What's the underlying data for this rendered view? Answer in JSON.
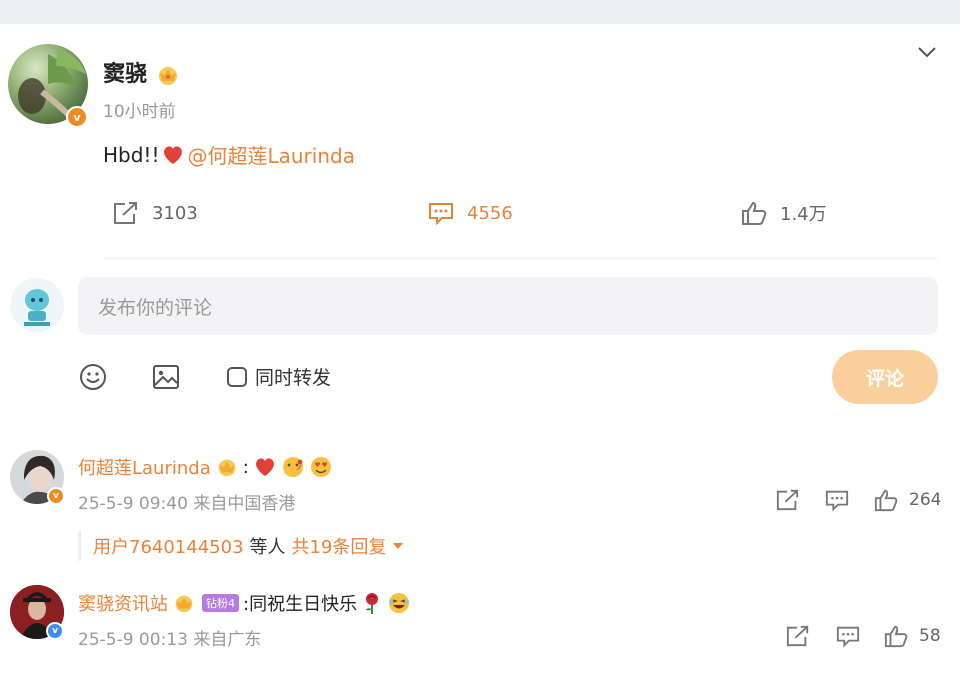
{
  "post": {
    "author": "窦骁",
    "time": "10小时前",
    "text": "Hbd!! ",
    "mention": "@何超莲Laurinda",
    "repost_count": "3103",
    "comment_count": "4556",
    "like_count": "1.4万"
  },
  "composer": {
    "placeholder": "发布你的评论",
    "repost_label": "同时转发",
    "submit_label": "评论"
  },
  "comments": [
    {
      "author": "何超莲Laurinda",
      "text": ":",
      "meta": "25-5-9 09:40 来自中国香港",
      "likes": "264",
      "replies": {
        "who": "用户7640144503",
        "mid": "等人",
        "count": "共19条回复"
      }
    },
    {
      "author": "窦骁资讯站",
      "fan_badge": "钻粉4",
      "text": ":同祝生日快乐",
      "meta": "25-5-9 00:13 来自广东",
      "likes": "58"
    }
  ],
  "colors": {
    "accent": "#e8833a",
    "submit_bg": "#fbcf9c",
    "verified_orange": "#f08a24",
    "verified_blue": "#3d8ef0"
  }
}
